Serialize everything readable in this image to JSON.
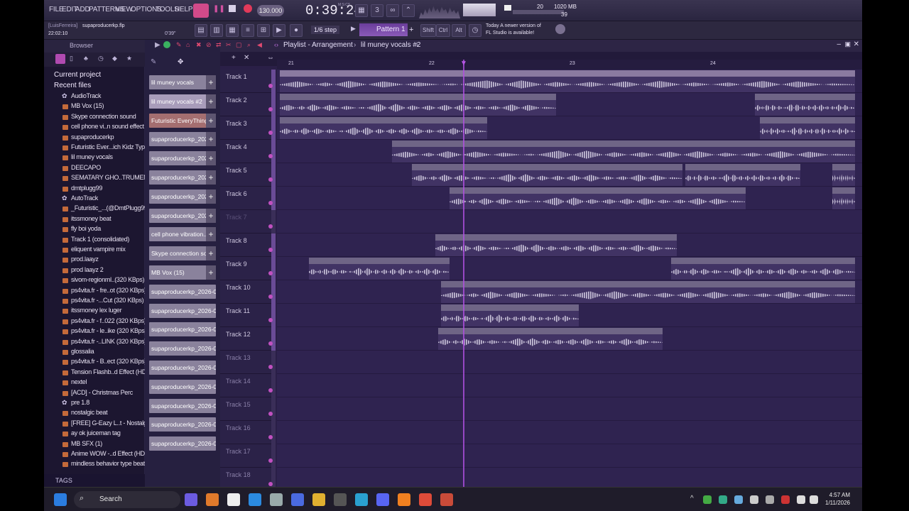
{
  "menu": [
    "FILE",
    "EDIT",
    "ADD",
    "PATTERNS",
    "VIEW",
    "OPTIONS",
    "TOOLS",
    "HELP"
  ],
  "transport": {
    "tempo": "130.000",
    "time": "0:39:24",
    "time_label": "M:S:CS"
  },
  "meters": {
    "memory": "1020 MB",
    "cpu": "20",
    "poly": "39"
  },
  "project": {
    "user": "[LuisFerreira]",
    "name": "supaproducerkp.flp",
    "time_display": "22:02:10",
    "elapsed": "0'39\""
  },
  "snap": "1/6 step",
  "pattern": "Pattern 1",
  "keys": [
    "Shift",
    "Ctrl",
    "Alt"
  ],
  "news": {
    "line1": "Today  A newer version of",
    "line2": "FL Studio is available!"
  },
  "browser": {
    "title": "Browser",
    "sections": [
      "Current project",
      "Recent files"
    ],
    "items": [
      {
        "label": "AudioTrack",
        "kind": "gear"
      },
      {
        "label": "MB Vox (15)",
        "kind": "file"
      },
      {
        "label": "Skype connection sound",
        "kind": "file"
      },
      {
        "label": "cell phone vi..n sound effect",
        "kind": "file"
      },
      {
        "label": "supaproducerkp",
        "kind": "file"
      },
      {
        "label": "Futuristic Ever...ich Kidz Type",
        "kind": "file"
      },
      {
        "label": "lil muney vocals",
        "kind": "file"
      },
      {
        "label": "DEECAPO",
        "kind": "file"
      },
      {
        "label": "SEMATARY GHO..TRUMENTAL",
        "kind": "file"
      },
      {
        "label": "dmtplugg99",
        "kind": "file"
      },
      {
        "label": "AutoTrack",
        "kind": "gear"
      },
      {
        "label": "_Futuristic_...(@DmtPlugg99)",
        "kind": "file"
      },
      {
        "label": "itssmoney beat",
        "kind": "file"
      },
      {
        "label": "fly boi yoda",
        "kind": "file"
      },
      {
        "label": "Track 1 (consolidated)",
        "kind": "file"
      },
      {
        "label": "eliquent vampire mix",
        "kind": "file"
      },
      {
        "label": "prod.laayz",
        "kind": "file"
      },
      {
        "label": "prod laayz 2",
        "kind": "file"
      },
      {
        "label": "sivom-regionml..(320 KBps)",
        "kind": "file"
      },
      {
        "label": "ps4vita.fr - fre..ot (320 KBps)",
        "kind": "file"
      },
      {
        "label": "ps4vita.fr -...Cut (320 KBps)",
        "kind": "file"
      },
      {
        "label": "itssmoney lex luger",
        "kind": "file"
      },
      {
        "label": "ps4vita.fr - f..022 (320 KBps)",
        "kind": "file"
      },
      {
        "label": "ps4vita.fr - le..ike (320 KBps)",
        "kind": "file"
      },
      {
        "label": "ps4vita.fr -..LINK (320 KBps)",
        "kind": "file"
      },
      {
        "label": "glossalia",
        "kind": "file"
      },
      {
        "label": "ps4vita.fr - B..ect (320 KBps)",
        "kind": "file"
      },
      {
        "label": "Tension Flashb..d Effect (HD)",
        "kind": "file"
      },
      {
        "label": "nextel",
        "kind": "file"
      },
      {
        "label": "[ACD] - Christmas Perc",
        "kind": "file"
      },
      {
        "label": "pre 1.8",
        "kind": "gear"
      },
      {
        "label": "nostalgic beat",
        "kind": "file"
      },
      {
        "label": "[FREE] G-Eazy L..t - Nostalgic",
        "kind": "file"
      },
      {
        "label": "ay ok juiceman tag",
        "kind": "file"
      },
      {
        "label": "MB SFX (1)",
        "kind": "file"
      },
      {
        "label": "Anime WOW -..d Effect (HD)",
        "kind": "file"
      },
      {
        "label": "mindless behavior type beat",
        "kind": "file"
      }
    ],
    "tags": "TAGS"
  },
  "channels": [
    "lil muney vocals",
    "lil muney vocals #2",
    "Futuristic EveryThing...",
    "supaproducerkp_2026-0...",
    "supaproducerkp_2026-0...",
    "supaproducerkp_2026-0...",
    "supaproducerkp_2026-0...",
    "supaproducerkp_2026-0...",
    "cell phone vibration...",
    "Skype connection so...",
    "MB Vox (15)",
    "supaproducerkp_2026-0...",
    "supaproducerkp_2026-0...",
    "supaproducerkp_2026-0...",
    "supaproducerkp_2026-0...",
    "supaproducerkp_2026-0...",
    "supaproducerkp_2026-0...",
    "supaproducerkp_2026-0...",
    "supaproducerkp_2026-0...",
    "supaproducerkp_2026-0..."
  ],
  "playlist": {
    "title": "Playlist - Arrangement",
    "current": "lil muney vocals #2",
    "ruler": [
      "21",
      "22",
      "23",
      "24"
    ],
    "tracks": [
      "Track 1",
      "Track 2",
      "Track 3",
      "Track 4",
      "Track 5",
      "Track 6",
      "Track 7",
      "Track 8",
      "Track 9",
      "Track 10",
      "Track 11",
      "Track 12",
      "Track 13",
      "Track 14",
      "Track 15",
      "Track 16",
      "Track 17",
      "Track 18"
    ],
    "clips": [
      {
        "track": 0,
        "name": "Futuristic EveryThing Rich Kidz Type",
        "start": 0.0,
        "end": 1.0
      },
      {
        "track": 1,
        "name": "lil muney vocals",
        "start": 0.0,
        "end": 0.48
      },
      {
        "track": 1,
        "name": "supaproducerkp_2026-01-11 02-48-14_REC",
        "start": 0.826,
        "end": 1.0
      },
      {
        "track": 2,
        "name": "supaproducerkp_2026-01-11 02-19-22_REC",
        "start": 0.0,
        "end": 0.36
      },
      {
        "track": 2,
        "name": "supaproducerkp_20..1-11 02-48-46_REC",
        "start": 0.835,
        "end": 1.0
      },
      {
        "track": 3,
        "name": "supaproducerkp_2026-01-11 02-44-28_REC",
        "start": 0.195,
        "end": 1.0
      },
      {
        "track": 4,
        "name": "supaproducerkp_2026-01-11 02-46-36_REC",
        "start": 0.23,
        "end": 0.7
      },
      {
        "track": 4,
        "name": "supaproducerkp_2026-01-11 02-46-36_REC",
        "start": 0.705,
        "end": 0.905
      },
      {
        "track": 4,
        "name": "sup..EC",
        "start": 0.96,
        "end": 1.0
      },
      {
        "track": 5,
        "name": "supaproducerkp_2026-01-11 02-47-04_REC",
        "start": 0.295,
        "end": 0.81
      },
      {
        "track": 5,
        "name": "su..C",
        "start": 0.96,
        "end": 1.0
      },
      {
        "track": 7,
        "name": "supaproducerkp_2026-01-11 03-01-14_REC",
        "start": 0.27,
        "end": 0.69
      },
      {
        "track": 8,
        "name": "Skype connection sound",
        "start": 0.05,
        "end": 0.295
      },
      {
        "track": 8,
        "name": "supaproducerkp_2026-01-11 03-01-14_REC",
        "start": 0.68,
        "end": 1.0
      },
      {
        "track": 9,
        "name": "supaproducerkp_2026-01-11 03-17-11_REC",
        "start": 0.28,
        "end": 1.0
      },
      {
        "track": 10,
        "name": "supaproducerkp_2026-01-11 03-21-33_REC",
        "start": 0.28,
        "end": 0.52
      },
      {
        "track": 11,
        "name": "lil muney vocals #2",
        "start": 0.275,
        "end": 0.665
      }
    ]
  },
  "taskbar": {
    "search": "Search",
    "time": "4:57 AM",
    "date": "1/11/2026"
  }
}
